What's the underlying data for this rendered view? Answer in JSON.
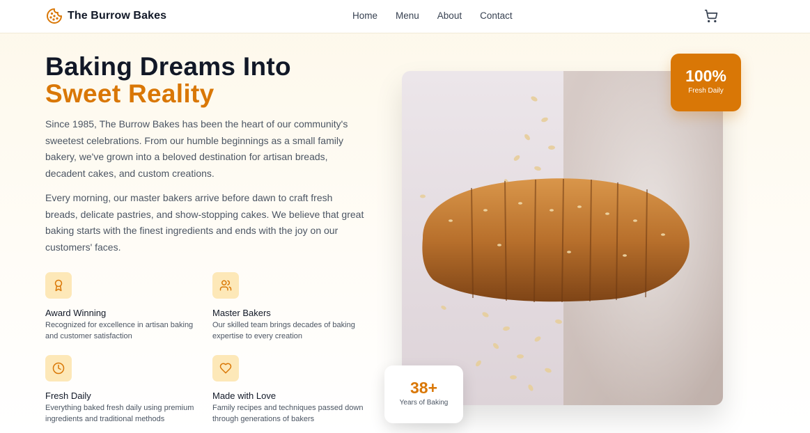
{
  "brand": {
    "name": "The Burrow Bakes",
    "icon": "cookie-icon"
  },
  "nav": {
    "items": [
      "Home",
      "Menu",
      "About",
      "Contact"
    ],
    "cart_icon": "cart-icon"
  },
  "hero": {
    "title_line1": "Baking Dreams Into",
    "title_line2": "Sweet Reality",
    "para1": "Since 1985, The Burrow Bakes has been the heart of our community's sweetest celebrations. From our humble beginnings as a small family bakery, we've grown into a beloved destination for artisan breads, decadent cakes, and custom creations.",
    "para2": "Every morning, our master bakers arrive before dawn to craft fresh breads, delicate pastries, and show-stopping cakes. We believe that great baking starts with the finest ingredients and ends with the joy on our customers' faces."
  },
  "features": [
    {
      "icon": "award-icon",
      "title": "Award Winning",
      "desc": "Recognized for excellence in artisan baking and customer satisfaction"
    },
    {
      "icon": "users-icon",
      "title": "Master Bakers",
      "desc": "Our skilled team brings decades of baking expertise to every creation"
    },
    {
      "icon": "clock-icon",
      "title": "Fresh Daily",
      "desc": "Everything baked fresh daily using premium ingredients and traditional methods"
    },
    {
      "icon": "heart-icon",
      "title": "Made with Love",
      "desc": "Family recipes and techniques passed down through generations of bakers"
    }
  ],
  "badges": {
    "top": {
      "value": "100%",
      "label": "Fresh Daily"
    },
    "bottom": {
      "value": "38+",
      "label": "Years of Baking"
    }
  },
  "colors": {
    "accent": "#d97706",
    "icon_bg": "#fde8b8",
    "text_dark": "#111827"
  }
}
